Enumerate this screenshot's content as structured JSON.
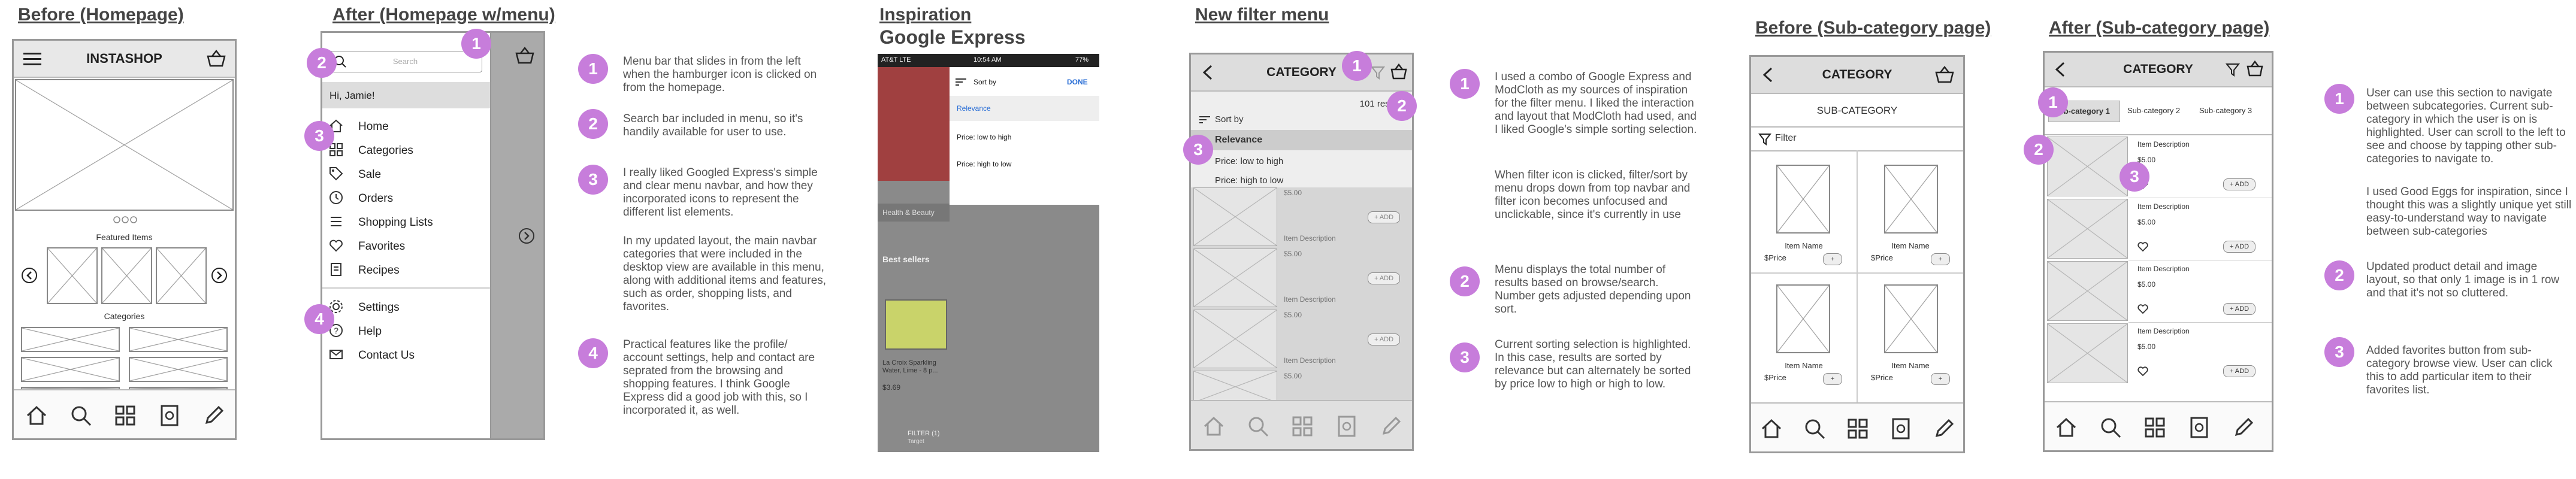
{
  "sections": {
    "before_home": "Before (Homepage)",
    "after_home": "After (Homepage w/menu)",
    "inspiration": "Inspiration",
    "inspiration_sub": "Google Express",
    "new_filter": "New filter menu",
    "before_sub": "Before (Sub-category page)",
    "after_sub": "After (Sub-category page)"
  },
  "before_home": {
    "app_title": "INSTASHOP",
    "featured_label": "Featured Items",
    "categories_label": "Categories"
  },
  "after_home": {
    "search_placeholder": "Search",
    "greeting": "Hi, Jamie!",
    "menu_main": [
      "Home",
      "Categories",
      "Sale",
      "Orders",
      "Shopping Lists",
      "Favorites",
      "Recipes"
    ],
    "menu_footer": [
      "Settings",
      "Help",
      "Contact Us"
    ],
    "notes": [
      "Menu bar that slides in from the left when the hamburger icon is clicked on from the homepage.",
      "Search bar included in menu, so it's handily available for user to use.",
      "I really liked Googled Express's simple and clear menu navbar, and how they incorporated icons to represent the different list elements.",
      "In my updated layout, the main navbar categories that were included in the desktop view are available in this menu, along with additional items and features, such as order, shopping lists, and favorites.",
      "Practical features like the profile/ account settings, help and contact are seprated from the browsing and shopping features. I think Google Express did a good job with this, so I incorporated it, as well."
    ]
  },
  "inspiration": {
    "carrier": "AT&T LTE",
    "time": "10:54 AM",
    "battery": "77%",
    "sort_by": "Sort by",
    "done": "DONE",
    "options": [
      "Relevance",
      "Price: low to high",
      "Price: high to low"
    ],
    "health": "Health & Beauty",
    "best_sellers": "Best sellers",
    "product_name": "La Croix Sparkling Water, Lime - 8 p...",
    "product_price": "$3.69",
    "filter_label": "FILTER (1)",
    "filter_sub": "Target"
  },
  "new_filter": {
    "title": "CATEGORY",
    "results": "101 results",
    "sort_by": "Sort by",
    "options": [
      "Relevance",
      "Price: low to high",
      "Price: high to low"
    ],
    "item_desc": "Item Description",
    "price": "$5.00",
    "add": "+ ADD",
    "notes": [
      "I used a combo of Google Express and ModCloth as my sources of inspiration for the filter menu. I liked the interaction and layout that ModCloth had used, and I liked Google's simple sorting selection.",
      "When filter icon is clicked, filter/sort by menu drops down from top navbar and filter icon becomes unfocused and unclickable, since it's currently in use",
      "Menu displays the total number of results based on browse/search. Number gets adjusted depending upon sort.",
      "Current sorting selection is highlighted. In this case, results are sorted by relevance but can alternately be sorted by price low to high or high to low."
    ]
  },
  "before_sub": {
    "title": "CATEGORY",
    "sub_title": "SUB-CATEGORY",
    "filter": "Filter",
    "item_name": "Item Name",
    "price": "$Price",
    "add": "+"
  },
  "after_sub": {
    "title": "CATEGORY",
    "tabs": [
      "Sub-category 1",
      "Sub-category 2",
      "Sub-category 3"
    ],
    "item_desc": "Item Description",
    "price": "$5.00",
    "add": "+ ADD",
    "notes": [
      "User can use this section to navigate between subcategories. Current sub-category in which the user is on is highlighted. User can scroll to the left to see and choose by tapping other sub-categories to navigate to.",
      "I used Good Eggs for inspiration, since I thought this was a slightly unique yet still easy-to-understand way to navigate between sub-categories",
      "Updated product detail and image layout, so that only 1 image is in 1 row and that it's not so cluttered.",
      "Added favorites button from sub-category browse view. User can click this to add particular item to their favorites list."
    ]
  },
  "badges": [
    "1",
    "2",
    "3",
    "4"
  ]
}
